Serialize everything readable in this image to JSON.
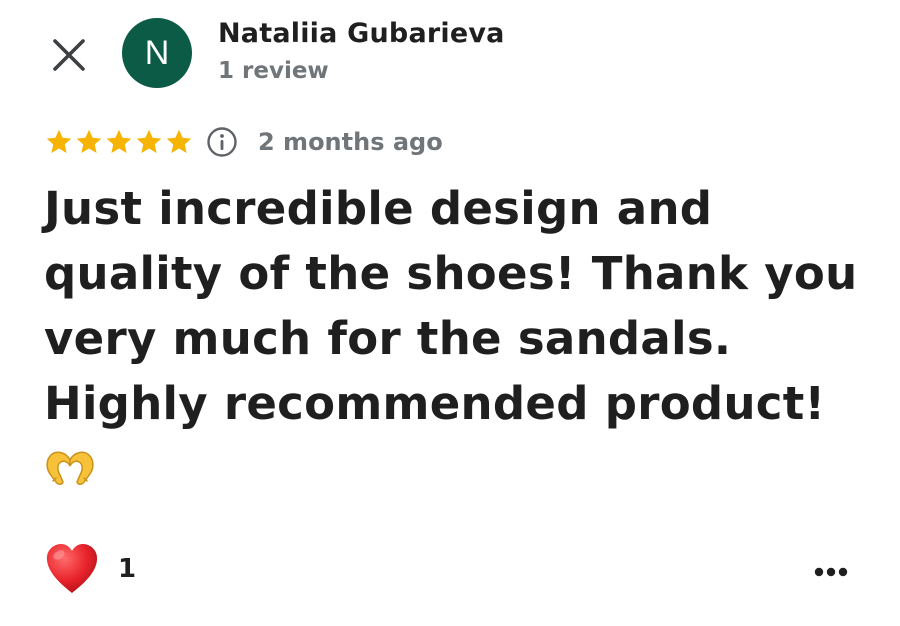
{
  "reviewer": {
    "initial": "N",
    "name": "Nataliia Gubarieva",
    "review_count": "1 review",
    "avatar_color": "#0b5b46"
  },
  "rating": {
    "stars": 5,
    "max_stars": 5,
    "star_color": "#f6b400",
    "time_ago": "2 months ago"
  },
  "review": {
    "text": "Just incredible design and quality of the shoes! Thank you very much for the sandals. Highly recommended product!",
    "emoji": "heart-hands-emoji"
  },
  "reactions": {
    "icon": "red-heart-icon",
    "count": "1"
  },
  "icons": {
    "close": "close-icon",
    "info": "info-icon",
    "more": "more-horizontal-icon"
  }
}
